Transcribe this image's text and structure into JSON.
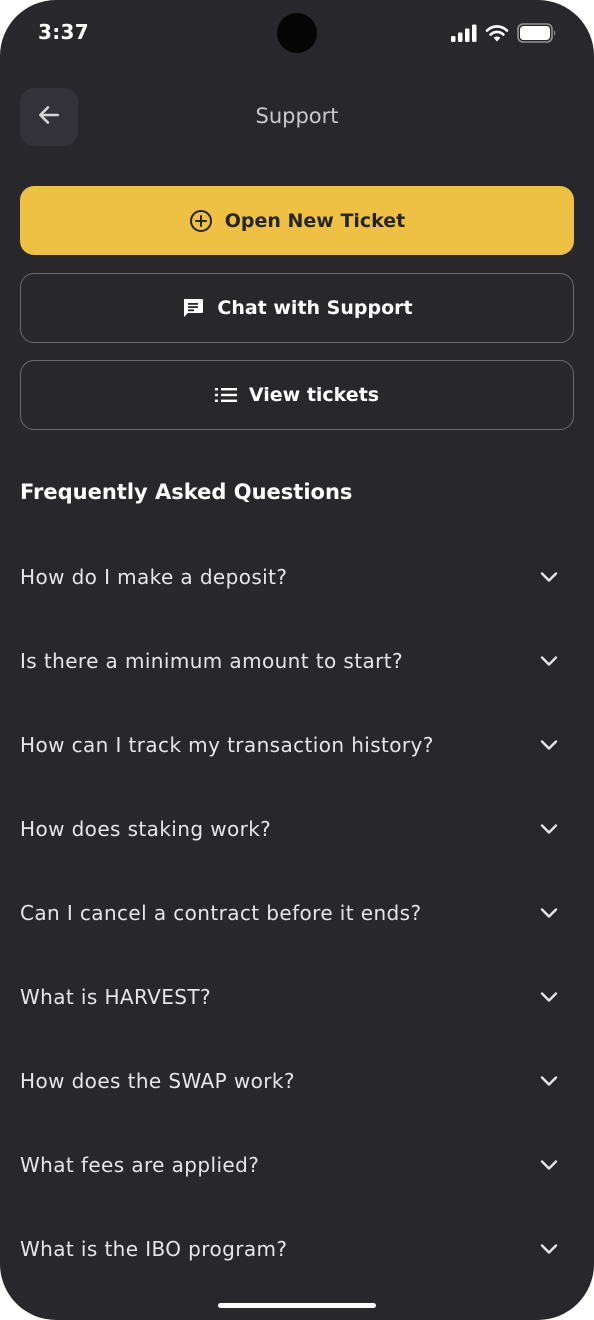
{
  "status_bar": {
    "time": "3:37",
    "icons": [
      "cellular-signal-icon",
      "wifi-icon",
      "battery-icon"
    ]
  },
  "header": {
    "back_icon": "arrow-left-icon",
    "title": "Support"
  },
  "actions": {
    "open_ticket": {
      "label": "Open New Ticket",
      "icon": "plus-circle-icon"
    },
    "chat_support": {
      "label": "Chat with Support",
      "icon": "chat-bubble-icon"
    },
    "view_tickets": {
      "label": "View tickets",
      "icon": "list-icon"
    }
  },
  "faq": {
    "title": "Frequently Asked Questions",
    "items": [
      {
        "question": "How do I make a deposit?"
      },
      {
        "question": "Is there a minimum amount to start?"
      },
      {
        "question": "How can I track my transaction history?"
      },
      {
        "question": "How does staking work?"
      },
      {
        "question": "Can I cancel a contract before it ends?"
      },
      {
        "question": "What is HARVEST?"
      },
      {
        "question": "How does the SWAP work?"
      },
      {
        "question": "What fees are applied?"
      },
      {
        "question": "What is the IBO program?"
      }
    ]
  },
  "colors": {
    "background": "#28272c",
    "accent": "#eec044",
    "outline": "#6b6a70",
    "surface": "#333238"
  }
}
